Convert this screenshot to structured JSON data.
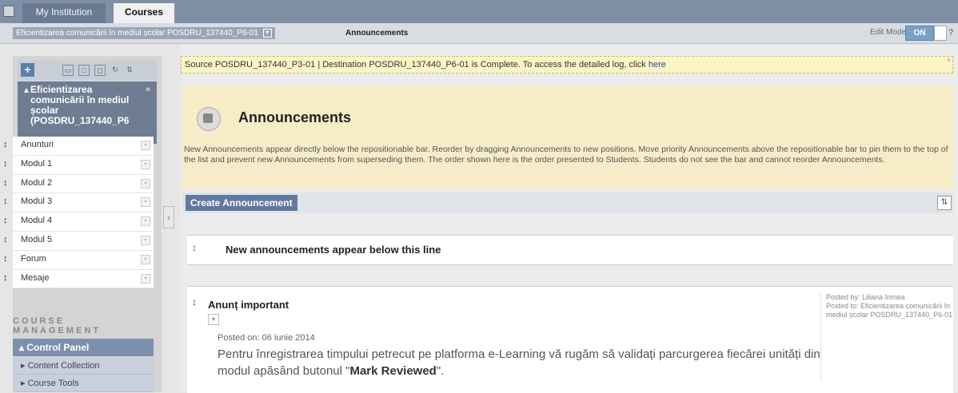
{
  "topbar": {
    "tabs": [
      {
        "label": "My Institution",
        "active": false
      },
      {
        "label": "Courses",
        "active": true
      }
    ]
  },
  "breadcrumb": {
    "course": "Eficientizarea comunicării în mediul școlar POSDRU_137440_P6-01",
    "page": "Announcements",
    "edit_mode_label": "Edit Mode is:",
    "edit_mode_value": "ON",
    "help": "?"
  },
  "sidebar": {
    "course_title": "Eficientizarea comunicării în mediul școlar (POSDRU_137440_P6",
    "items": [
      {
        "label": "Anunturi"
      },
      {
        "label": "Modul 1"
      },
      {
        "label": "Modul 2"
      },
      {
        "label": "Modul 3"
      },
      {
        "label": "Modul 4"
      },
      {
        "label": "Modul 5"
      },
      {
        "label": "Forum"
      },
      {
        "label": "Mesaje"
      }
    ],
    "course_management": "COURSE MANAGEMENT",
    "control_panel": "Control Panel",
    "cp_items": [
      {
        "label": "Content Collection"
      },
      {
        "label": "Course Tools"
      }
    ]
  },
  "notice": {
    "text": "Source POSDRU_137440_P3-01 | Destination POSDRU_137440_P6-01 is Complete. To access the detailed log, click",
    "link": "here"
  },
  "page": {
    "title": "Announcements",
    "description": "New Announcements appear directly below the repositionable bar. Reorder by dragging Announcements to new positions. Move priority Announcements above the repositionable bar to pin them to the top of the list and prevent new Announcements from superseding them. The order shown here is the order presented to Students. Students do not see the bar and cannot reorder Announcements.",
    "create_button": "Create Announcement",
    "separator_text": "New announcements appear below this line"
  },
  "announcement": {
    "title": "Anunț important",
    "posted_on": "Posted on: 06 iunie 2014",
    "body_prefix": "Pentru înregistrarea timpului petrecut pe platforma e-Learning vă rugăm să validați parcurgerea fiecărei unități din modul apăsând butonul \"",
    "body_bold": "Mark Reviewed",
    "body_suffix": "\".",
    "posted_by": "Posted by: Liliana Irimea",
    "posted_to": "Posted to: Eficientizarea comunicării în mediul școlar POSDRU_137440_P6-01"
  }
}
